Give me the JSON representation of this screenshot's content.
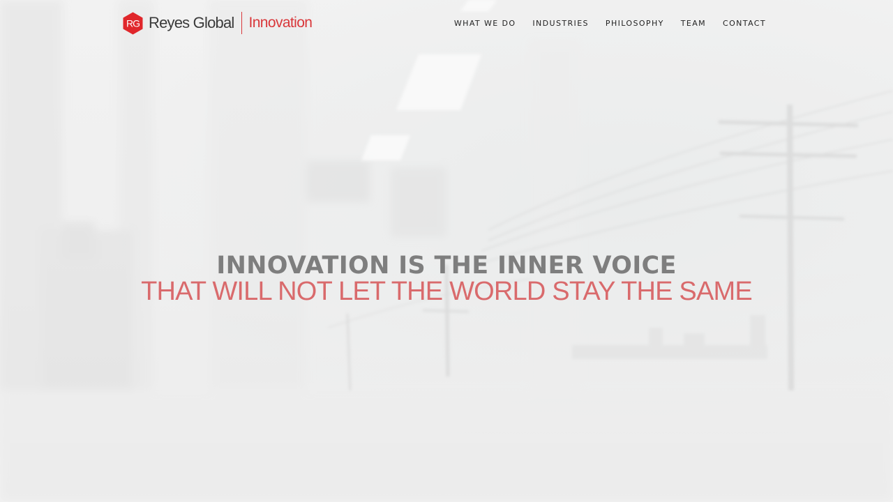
{
  "brand": {
    "monogram": "RG",
    "company": "Reyes Global",
    "tagline": "Innovation",
    "accent_color": "#d9373a"
  },
  "nav": {
    "items": [
      {
        "label": "WHAT WE DO"
      },
      {
        "label": "INDUSTRIES"
      },
      {
        "label": "PHILOSOPHY"
      },
      {
        "label": "TEAM"
      },
      {
        "label": "CONTACT"
      }
    ]
  },
  "hero": {
    "headline": "INNOVATION IS THE INNER VOICE",
    "subheadline": "THAT WILL NOT LET THE WORLD STAY THE SAME",
    "headline_color": "#7e7e7e",
    "subheadline_color": "#d96a6c"
  }
}
